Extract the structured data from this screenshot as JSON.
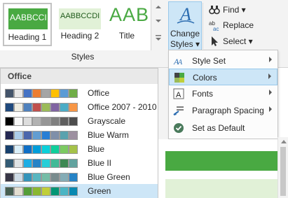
{
  "ribbon": {
    "style_tiles": [
      {
        "sample": "AABBCCI",
        "label": "Heading 1"
      },
      {
        "sample": "AABBCCDI",
        "label": "Heading 2"
      },
      {
        "sample": "AAB",
        "label": "Title"
      }
    ],
    "group_label": "Styles",
    "change_styles": {
      "line1": "Change",
      "line2": "Styles ▾"
    },
    "editing": [
      {
        "label": "Find ▾",
        "icon": "binoculars-icon"
      },
      {
        "label": "Replace",
        "icon": "replace-icon"
      },
      {
        "label": "Select ▾",
        "icon": "select-cursor-icon"
      }
    ]
  },
  "colors_panel": {
    "header": "Office",
    "themes": [
      {
        "name": "Office",
        "colors": [
          "#44546a",
          "#e7e6e6",
          "#4472c4",
          "#ed7d31",
          "#a5a5a5",
          "#ffc000",
          "#5b9bd5",
          "#70ad47"
        ]
      },
      {
        "name": "Office 2007 - 2010",
        "colors": [
          "#1f497d",
          "#eeece1",
          "#4f81bd",
          "#c0504d",
          "#9bbb59",
          "#8064a2",
          "#4bacc6",
          "#f79646"
        ]
      },
      {
        "name": "Grayscale",
        "colors": [
          "#000000",
          "#f8f8f8",
          "#dddddd",
          "#b2b2b2",
          "#969696",
          "#808080",
          "#5f5f5f",
          "#4d4d4d"
        ]
      },
      {
        "name": "Blue Warm",
        "colors": [
          "#242852",
          "#acccea",
          "#4a66ac",
          "#629dd1",
          "#297fd5",
          "#7f8fa9",
          "#5aa2ae",
          "#9d90a0"
        ]
      },
      {
        "name": "Blue",
        "colors": [
          "#17406d",
          "#dbeff9",
          "#0f6fc6",
          "#009dd9",
          "#0bd0d9",
          "#10cf9b",
          "#7cca62",
          "#a5c249"
        ]
      },
      {
        "name": "Blue II",
        "colors": [
          "#335b74",
          "#dfe3e5",
          "#1cade4",
          "#2683c6",
          "#27ced7",
          "#42ba97",
          "#3e8853",
          "#62a39f"
        ]
      },
      {
        "name": "Blue Green",
        "colors": [
          "#373545",
          "#cedbe6",
          "#3494ba",
          "#58b6c0",
          "#75bda7",
          "#7a8c8e",
          "#84acb6",
          "#2683c6"
        ]
      },
      {
        "name": "Green",
        "colors": [
          "#455f51",
          "#e3ded1",
          "#549e39",
          "#8ab833",
          "#c0cf3a",
          "#029676",
          "#4ab5c4",
          "#0989b1"
        ]
      }
    ],
    "selected": "Green"
  },
  "menu": {
    "items": [
      {
        "label": "Style Set",
        "icon": "style-set-icon",
        "submenu": true
      },
      {
        "label": "Colors",
        "icon": "colors-icon",
        "submenu": true
      },
      {
        "label": "Fonts",
        "icon": "fonts-icon",
        "submenu": true
      },
      {
        "label": "Paragraph Spacing",
        "icon": "paragraph-spacing-icon",
        "submenu": true
      },
      {
        "label": "Set as Default",
        "icon": "checkmark-icon",
        "submenu": false
      }
    ],
    "highlighted": "Colors"
  },
  "colors": {
    "accent": "#49a942",
    "selection": "#cde6f7",
    "light_green": "#e1f1d7"
  }
}
